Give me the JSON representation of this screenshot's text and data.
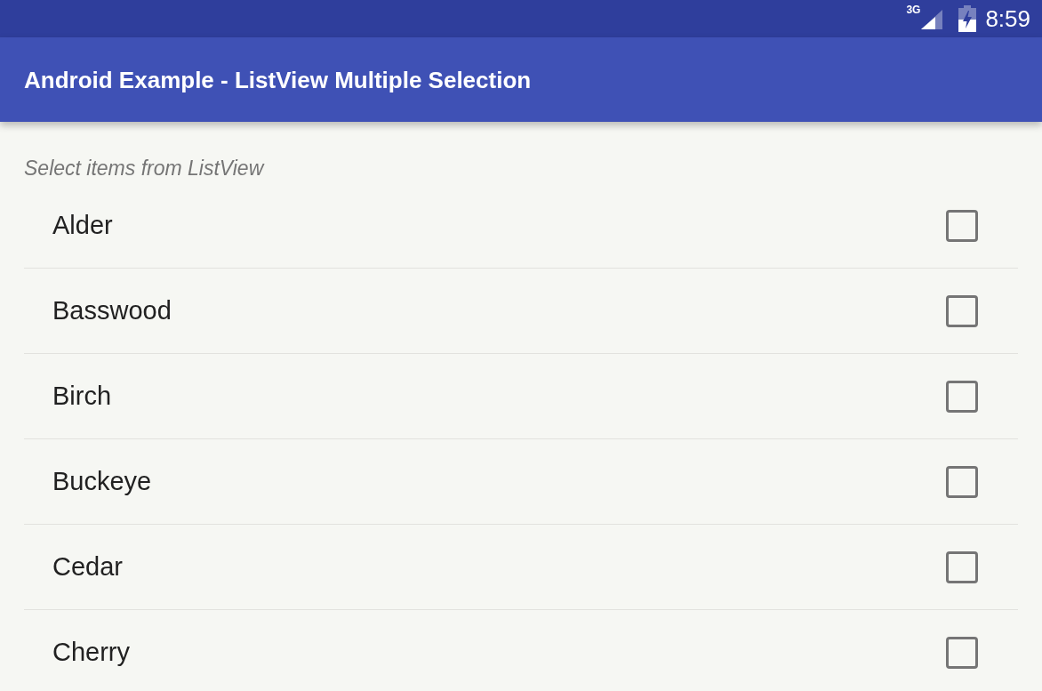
{
  "status_bar": {
    "network": "3G",
    "time": "8:59"
  },
  "app_bar": {
    "title": "Android Example - ListView Multiple Selection"
  },
  "list": {
    "hint": "Select items from ListView",
    "items": [
      {
        "label": "Alder",
        "checked": false
      },
      {
        "label": "Basswood",
        "checked": false
      },
      {
        "label": "Birch",
        "checked": false
      },
      {
        "label": "Buckeye",
        "checked": false
      },
      {
        "label": "Cedar",
        "checked": false
      },
      {
        "label": "Cherry",
        "checked": false
      }
    ]
  }
}
